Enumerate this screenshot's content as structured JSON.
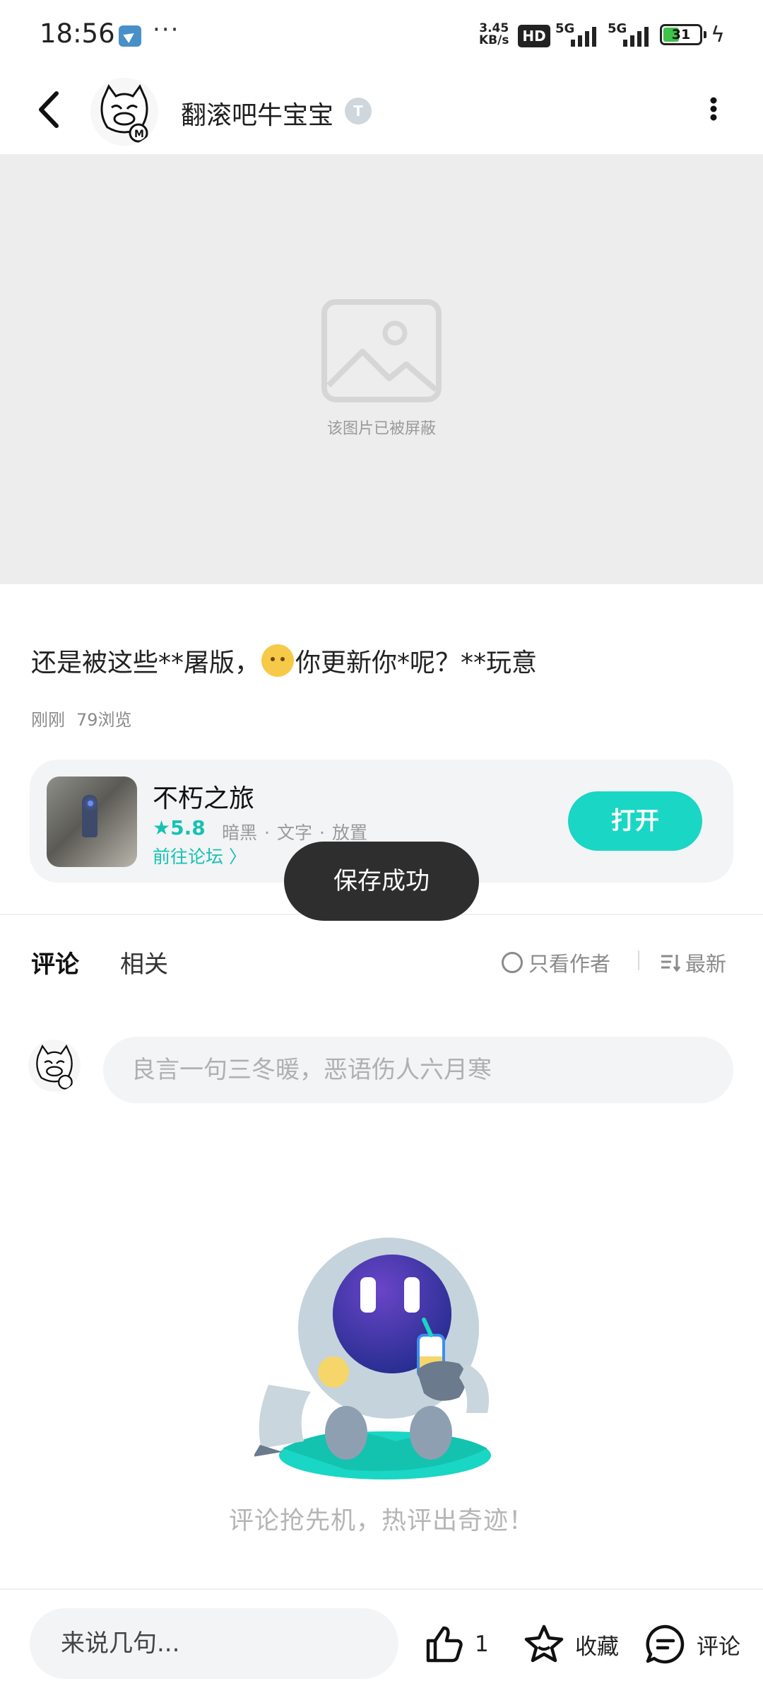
{
  "status_bar": {
    "time": "18:56",
    "more": "···",
    "net_speed_value": "3.45",
    "net_speed_unit": "KB/s",
    "hd": "HD",
    "sig1": "5G",
    "sig2": "5G",
    "battery": "31"
  },
  "header": {
    "username": "翻滚吧牛宝宝",
    "level_badge": "T"
  },
  "image": {
    "blocked_text": "该图片已被屏蔽"
  },
  "post": {
    "text_before_emoji": "还是被这些**屠版，",
    "text_after_emoji": "你更新你*呢？**玩意",
    "time": "刚刚",
    "views": "79浏览"
  },
  "game_card": {
    "name": "不朽之旅",
    "score": "★5.8",
    "tags": [
      "暗黑",
      "文字",
      "放置"
    ],
    "tag_separator": "·",
    "forum_link": "前往论坛 〉",
    "open_button": "打开"
  },
  "toast": "保存成功",
  "tabs": {
    "comments": "评论",
    "related": "相关",
    "only_author": "只看作者",
    "sort": "最新"
  },
  "composer": {
    "placeholder": "良言一句三冬暖，恶语伤人六月寒"
  },
  "empty_state": {
    "text": "评论抢先机，热评出奇迹！"
  },
  "bottom_bar": {
    "input_placeholder": "来说几句...",
    "like_count": "1",
    "favorite": "收藏",
    "comment": "评论"
  },
  "colors": {
    "accent": "#1ad6c4",
    "accent_text": "#16c2b4",
    "toast_bg": "#2e2e2e",
    "blocked_bg": "#ededed"
  },
  "icons": [
    "back-icon",
    "more-vertical-icon",
    "image-placeholder-icon",
    "star-icon",
    "chevron-right-icon",
    "sort-icon",
    "like-icon",
    "favorite-star-icon",
    "comment-icon",
    "lightning-icon"
  ]
}
